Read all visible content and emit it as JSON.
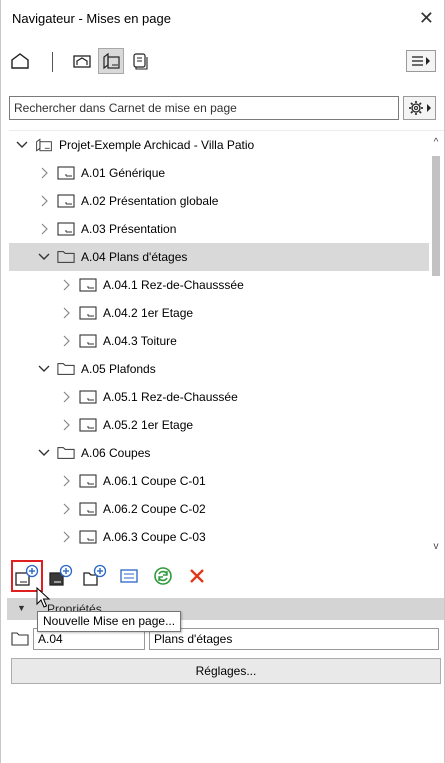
{
  "window": {
    "title": "Navigateur - Mises en page"
  },
  "search": {
    "placeholder": "Rechercher dans Carnet de mise en page"
  },
  "tree": {
    "items": [
      {
        "label": "Projet-Exemple Archicad - Villa Patio",
        "level": 0,
        "expanded": true,
        "icon": "layout-book-icon",
        "selected": false
      },
      {
        "label": "A.01 Générique",
        "level": 1,
        "expanded": false,
        "icon": "layout-icon",
        "selected": false
      },
      {
        "label": "A.02 Présentation globale",
        "level": 1,
        "expanded": false,
        "icon": "layout-icon",
        "selected": false
      },
      {
        "label": "A.03 Présentation",
        "level": 1,
        "expanded": false,
        "icon": "layout-icon",
        "selected": false
      },
      {
        "label": "A.04 Plans d'étages",
        "level": 1,
        "expanded": true,
        "icon": "folder-icon",
        "selected": true
      },
      {
        "label": "A.04.1 Rez-de-Chausssée",
        "level": 2,
        "expanded": false,
        "icon": "layout-icon",
        "selected": false
      },
      {
        "label": "A.04.2 1er Etage",
        "level": 2,
        "expanded": false,
        "icon": "layout-icon",
        "selected": false
      },
      {
        "label": "A.04.3 Toiture",
        "level": 2,
        "expanded": false,
        "icon": "layout-icon",
        "selected": false
      },
      {
        "label": "A.05 Plafonds",
        "level": 1,
        "expanded": true,
        "icon": "folder-icon",
        "selected": false
      },
      {
        "label": "A.05.1 Rez-de-Chaussée",
        "level": 2,
        "expanded": false,
        "icon": "layout-icon",
        "selected": false
      },
      {
        "label": "A.05.2 1er Etage",
        "level": 2,
        "expanded": false,
        "icon": "layout-icon",
        "selected": false
      },
      {
        "label": "A.06 Coupes",
        "level": 1,
        "expanded": true,
        "icon": "folder-icon",
        "selected": false
      },
      {
        "label": "A.06.1 Coupe C-01",
        "level": 2,
        "expanded": false,
        "icon": "layout-icon",
        "selected": false
      },
      {
        "label": "A.06.2 Coupe C-02",
        "level": 2,
        "expanded": false,
        "icon": "layout-icon",
        "selected": false
      },
      {
        "label": "A.06.3 Coupe C-03",
        "level": 2,
        "expanded": false,
        "icon": "layout-icon",
        "selected": false
      }
    ]
  },
  "toolbar": {
    "tooltip": "Nouvelle Mise en page...",
    "highlight_color": "#e02020",
    "refresh_color": "#2e9a3a",
    "delete_color": "#e03a1a",
    "accent_color": "#2a66c8"
  },
  "properties": {
    "header": "Propriétés",
    "id_value": "A.04",
    "name_value": "Plans d'étages",
    "settings_label": "Réglages..."
  },
  "icons": {
    "close": "close-icon",
    "project_map": "project-map-icon",
    "view_map": "view-map-icon",
    "layout_book": "layout-book-icon",
    "publisher": "publisher-icon",
    "menu": "menu-icon",
    "gear": "gear-icon"
  }
}
